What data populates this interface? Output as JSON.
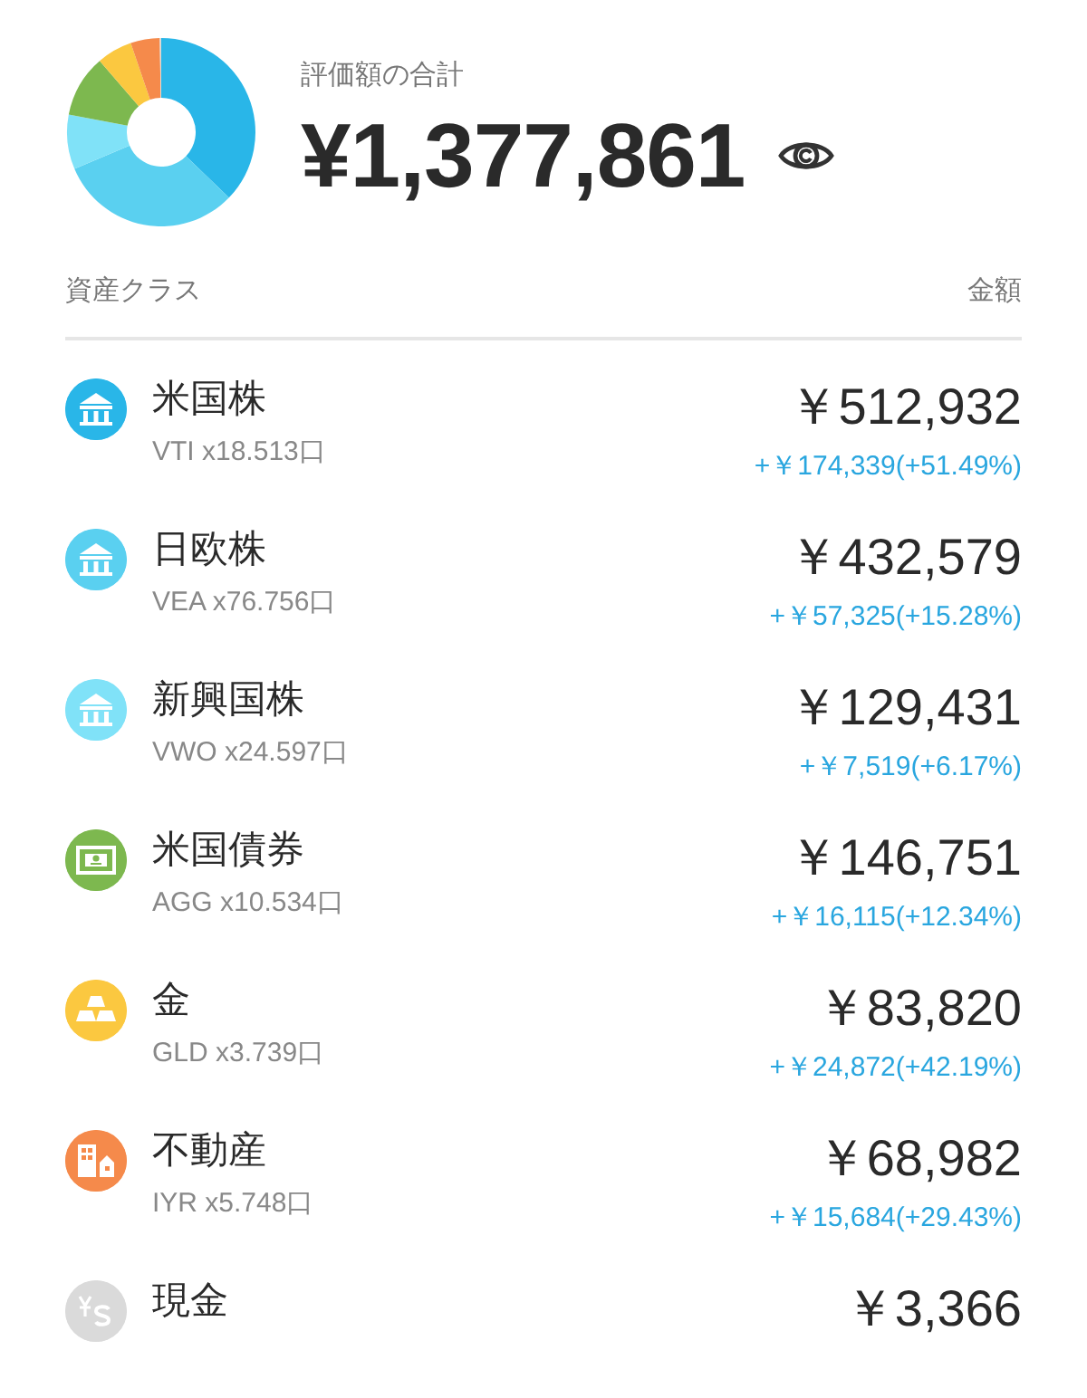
{
  "summary": {
    "label": "評価額の合計",
    "total": "¥1,377,861"
  },
  "columns": {
    "asset_class": "資産クラス",
    "amount": "金額"
  },
  "assets": [
    {
      "kind": "bank",
      "color": "#29b6e8",
      "name": "米国株",
      "holding": "VTI x18.513口",
      "amount": "￥512,932",
      "gain": "+￥174,339(+51.49%)"
    },
    {
      "kind": "bank",
      "color": "#5ad0f0",
      "name": "日欧株",
      "holding": "VEA x76.756口",
      "amount": "￥432,579",
      "gain": "+￥57,325(+15.28%)"
    },
    {
      "kind": "bank",
      "color": "#80e2f8",
      "name": "新興国株",
      "holding": "VWO x24.597口",
      "amount": "￥129,431",
      "gain": "+￥7,519(+6.17%)"
    },
    {
      "kind": "bill",
      "color": "#7db84f",
      "name": "米国債券",
      "holding": "AGG x10.534口",
      "amount": "￥146,751",
      "gain": "+￥16,115(+12.34%)"
    },
    {
      "kind": "gold",
      "color": "#fbc840",
      "name": "金",
      "holding": "GLD x3.739口",
      "amount": "￥83,820",
      "gain": "+￥24,872(+42.19%)"
    },
    {
      "kind": "building",
      "color": "#f58a4b",
      "name": "不動産",
      "holding": "IYR x5.748口",
      "amount": "￥68,982",
      "gain": "+￥15,684(+29.43%)"
    },
    {
      "kind": "cash",
      "color": "#dadada",
      "name": "現金",
      "amount": "￥3,366"
    }
  ]
}
